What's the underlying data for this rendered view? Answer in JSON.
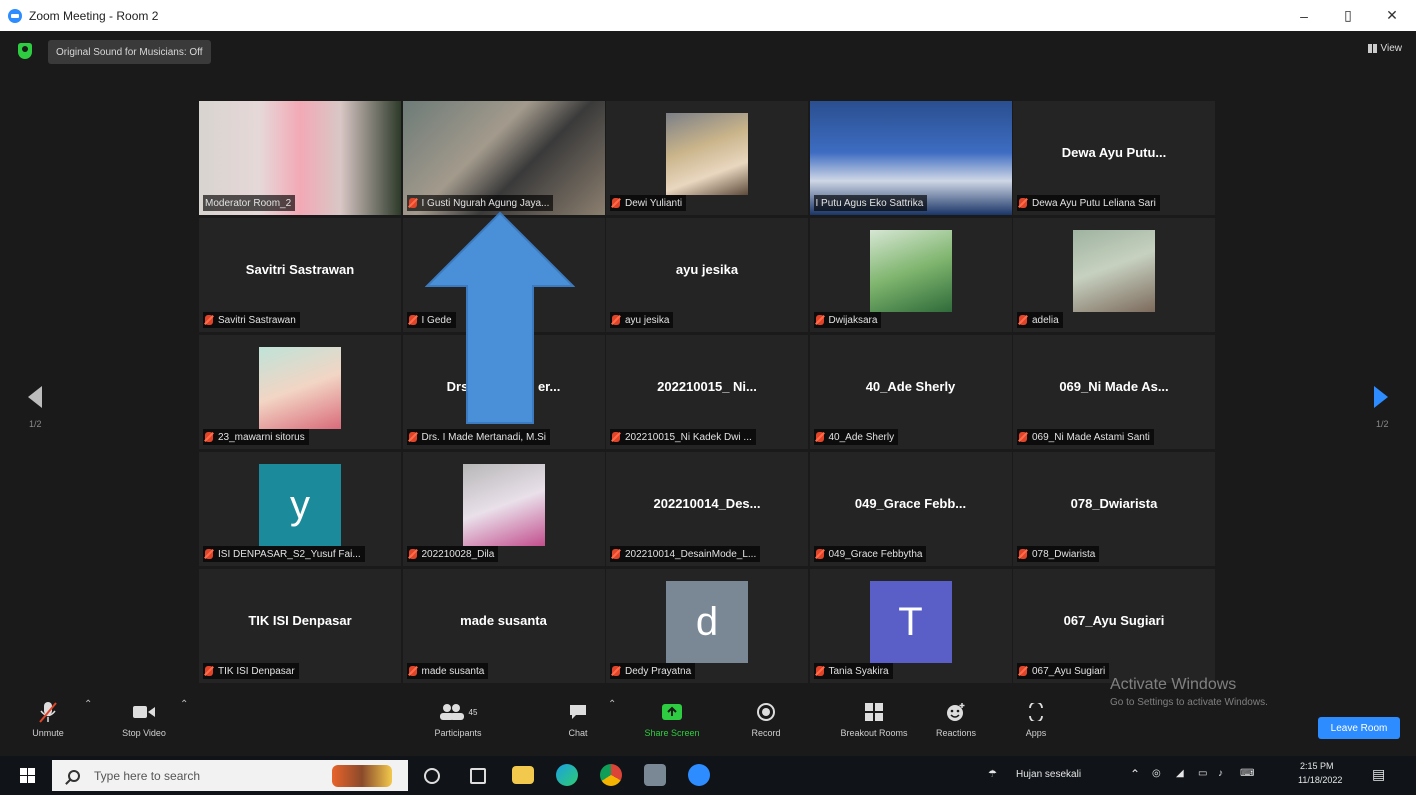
{
  "window": {
    "title": "Zoom Meeting - Room 2",
    "minimize": "–",
    "maximize": "▯",
    "close": "✕"
  },
  "meeting": {
    "sound_badge": "Original Sound for Musicians: Off",
    "view_label": "View",
    "page_left": "1/2",
    "page_right": "1/2"
  },
  "tiles": [
    {
      "big": "",
      "label": "Moderator Room_2",
      "muted": false,
      "kind": "video",
      "active": true
    },
    {
      "big": "",
      "label": "I Gusti Ngurah Agung Jaya...",
      "muted": true,
      "kind": "video"
    },
    {
      "big": "",
      "label": "Dewi Yulianti",
      "muted": true,
      "kind": "photo"
    },
    {
      "big": "",
      "label": "I Putu Agus Eko Sattrika",
      "muted": false,
      "kind": "video"
    },
    {
      "big": "Dewa Ayu Putu...",
      "label": "Dewa Ayu Putu Leliana Sari",
      "muted": true,
      "kind": "name"
    },
    {
      "big": "Savitri Sastrawan",
      "label": "Savitri Sastrawan",
      "muted": true,
      "kind": "name"
    },
    {
      "big": "",
      "label": "I Gede",
      "muted": true,
      "kind": "name"
    },
    {
      "big": "ayu jesika",
      "label": "ayu jesika",
      "muted": true,
      "kind": "name"
    },
    {
      "big": "",
      "label": "Dwijaksara",
      "muted": true,
      "kind": "photo"
    },
    {
      "big": "",
      "label": "adelia",
      "muted": true,
      "kind": "photo"
    },
    {
      "big": "",
      "label": "23_mawarni sitorus",
      "muted": true,
      "kind": "photo"
    },
    {
      "big": "Drs.",
      "big_suffix": "er...",
      "label": "Drs. I Made Mertanadi, M.Si",
      "muted": true,
      "kind": "name"
    },
    {
      "big": "202210015_ Ni...",
      "label": "202210015_Ni Kadek Dwi ...",
      "muted": true,
      "kind": "name"
    },
    {
      "big": "40_Ade Sherly",
      "label": "40_Ade Sherly",
      "muted": true,
      "kind": "name"
    },
    {
      "big": "069_Ni Made As...",
      "label": "069_Ni Made Astami Santi",
      "muted": true,
      "kind": "name"
    },
    {
      "big": "",
      "letter": "y",
      "label": "ISI DENPASAR_S2_Yusuf Fai...",
      "muted": true,
      "kind": "letter"
    },
    {
      "big": "",
      "label": "202210028_Dila",
      "muted": true,
      "kind": "photo"
    },
    {
      "big": "202210014_Des...",
      "label": "202210014_DesainMode_L...",
      "muted": true,
      "kind": "name"
    },
    {
      "big": "049_Grace Febb...",
      "label": "049_Grace Febbytha",
      "muted": true,
      "kind": "name"
    },
    {
      "big": "078_Dwiarista",
      "label": "078_Dwiarista",
      "muted": true,
      "kind": "name"
    },
    {
      "big": "TIK ISI Denpasar",
      "label": "TIK ISI Denpasar",
      "muted": true,
      "kind": "name"
    },
    {
      "big": "made susanta",
      "label": "made susanta",
      "muted": true,
      "kind": "name"
    },
    {
      "big": "",
      "letter": "d",
      "label": "Dedy Prayatna",
      "muted": true,
      "kind": "letter"
    },
    {
      "big": "",
      "letter": "T",
      "label": "Tania Syakira",
      "muted": true,
      "kind": "letter"
    },
    {
      "big": "067_Ayu Sugiari",
      "label": "067_Ayu Sugiari",
      "muted": true,
      "kind": "name"
    }
  ],
  "toolbar": {
    "unmute": "Unmute",
    "stop_video": "Stop Video",
    "participants": "Participants",
    "participants_count": "45",
    "chat": "Chat",
    "share_screen": "Share Screen",
    "record": "Record",
    "breakout": "Breakout Rooms",
    "reactions": "Reactions",
    "apps": "Apps",
    "leave": "Leave Room"
  },
  "watermark": {
    "line1": "Activate Windows",
    "line2": "Go to Settings to activate Windows."
  },
  "taskbar": {
    "search_placeholder": "Type here to search",
    "weather": "Hujan sesekali",
    "time": "2:15 PM",
    "date": "11/18/2022"
  },
  "colors": {
    "accent": "#2d8cff",
    "active_border": "#c9e34c",
    "annotation_arrow": "#4a90d9"
  }
}
